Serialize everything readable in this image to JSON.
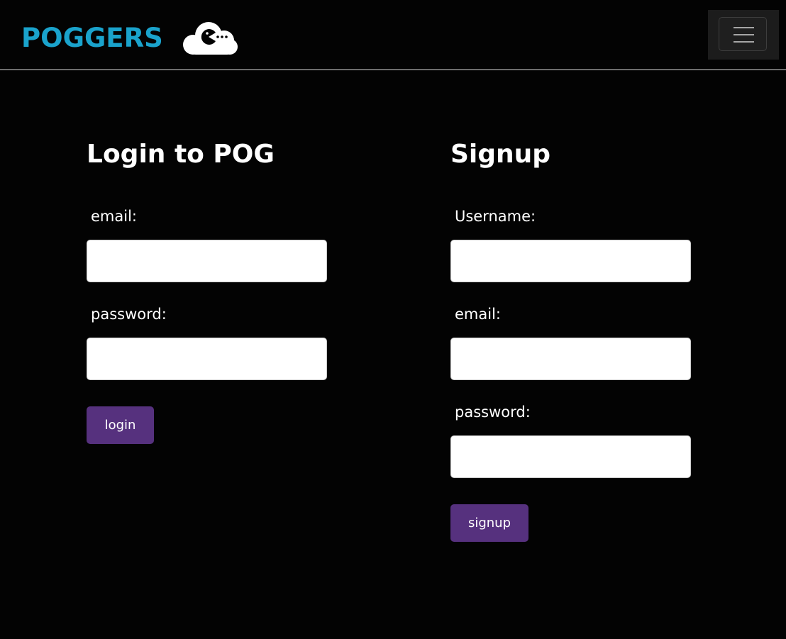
{
  "navbar": {
    "brand": "POGGERS",
    "logo_icon": "cloud-pacman-icon",
    "menu_icon": "hamburger-menu-icon",
    "colors": {
      "brand": "#1aa3cc",
      "background": "#030303",
      "button": "#56317e"
    }
  },
  "login": {
    "title": "Login to POG",
    "email_label": "email:",
    "email_value": "",
    "password_label": "password:",
    "password_value": "",
    "button_label": "login"
  },
  "signup": {
    "title": "Signup",
    "username_label": "Username:",
    "username_value": "",
    "email_label": "email:",
    "email_value": "",
    "password_label": "password:",
    "password_value": "",
    "button_label": "signup"
  }
}
